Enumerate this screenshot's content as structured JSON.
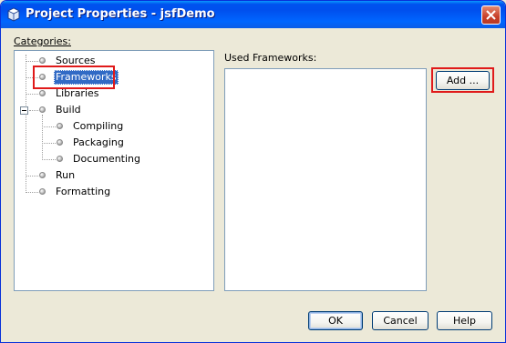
{
  "window": {
    "title": "Project Properties - jsfDemo"
  },
  "categories": {
    "label": "Categories:",
    "items": [
      {
        "label": "Sources"
      },
      {
        "label": "Frameworks"
      },
      {
        "label": "Libraries"
      },
      {
        "label": "Build"
      },
      {
        "label": "Compiling"
      },
      {
        "label": "Packaging"
      },
      {
        "label": "Documenting"
      },
      {
        "label": "Run"
      },
      {
        "label": "Formatting"
      }
    ]
  },
  "frameworks": {
    "label": "Used Frameworks:",
    "add_label": "Add ..."
  },
  "footer": {
    "ok_label": "OK",
    "cancel_label": "Cancel",
    "help_label": "Help"
  },
  "colors": {
    "titlebar": "#0053ee",
    "selection": "#316ac5",
    "annotation_box": "#e01a1a",
    "dialog_bg": "#ece9d8"
  }
}
